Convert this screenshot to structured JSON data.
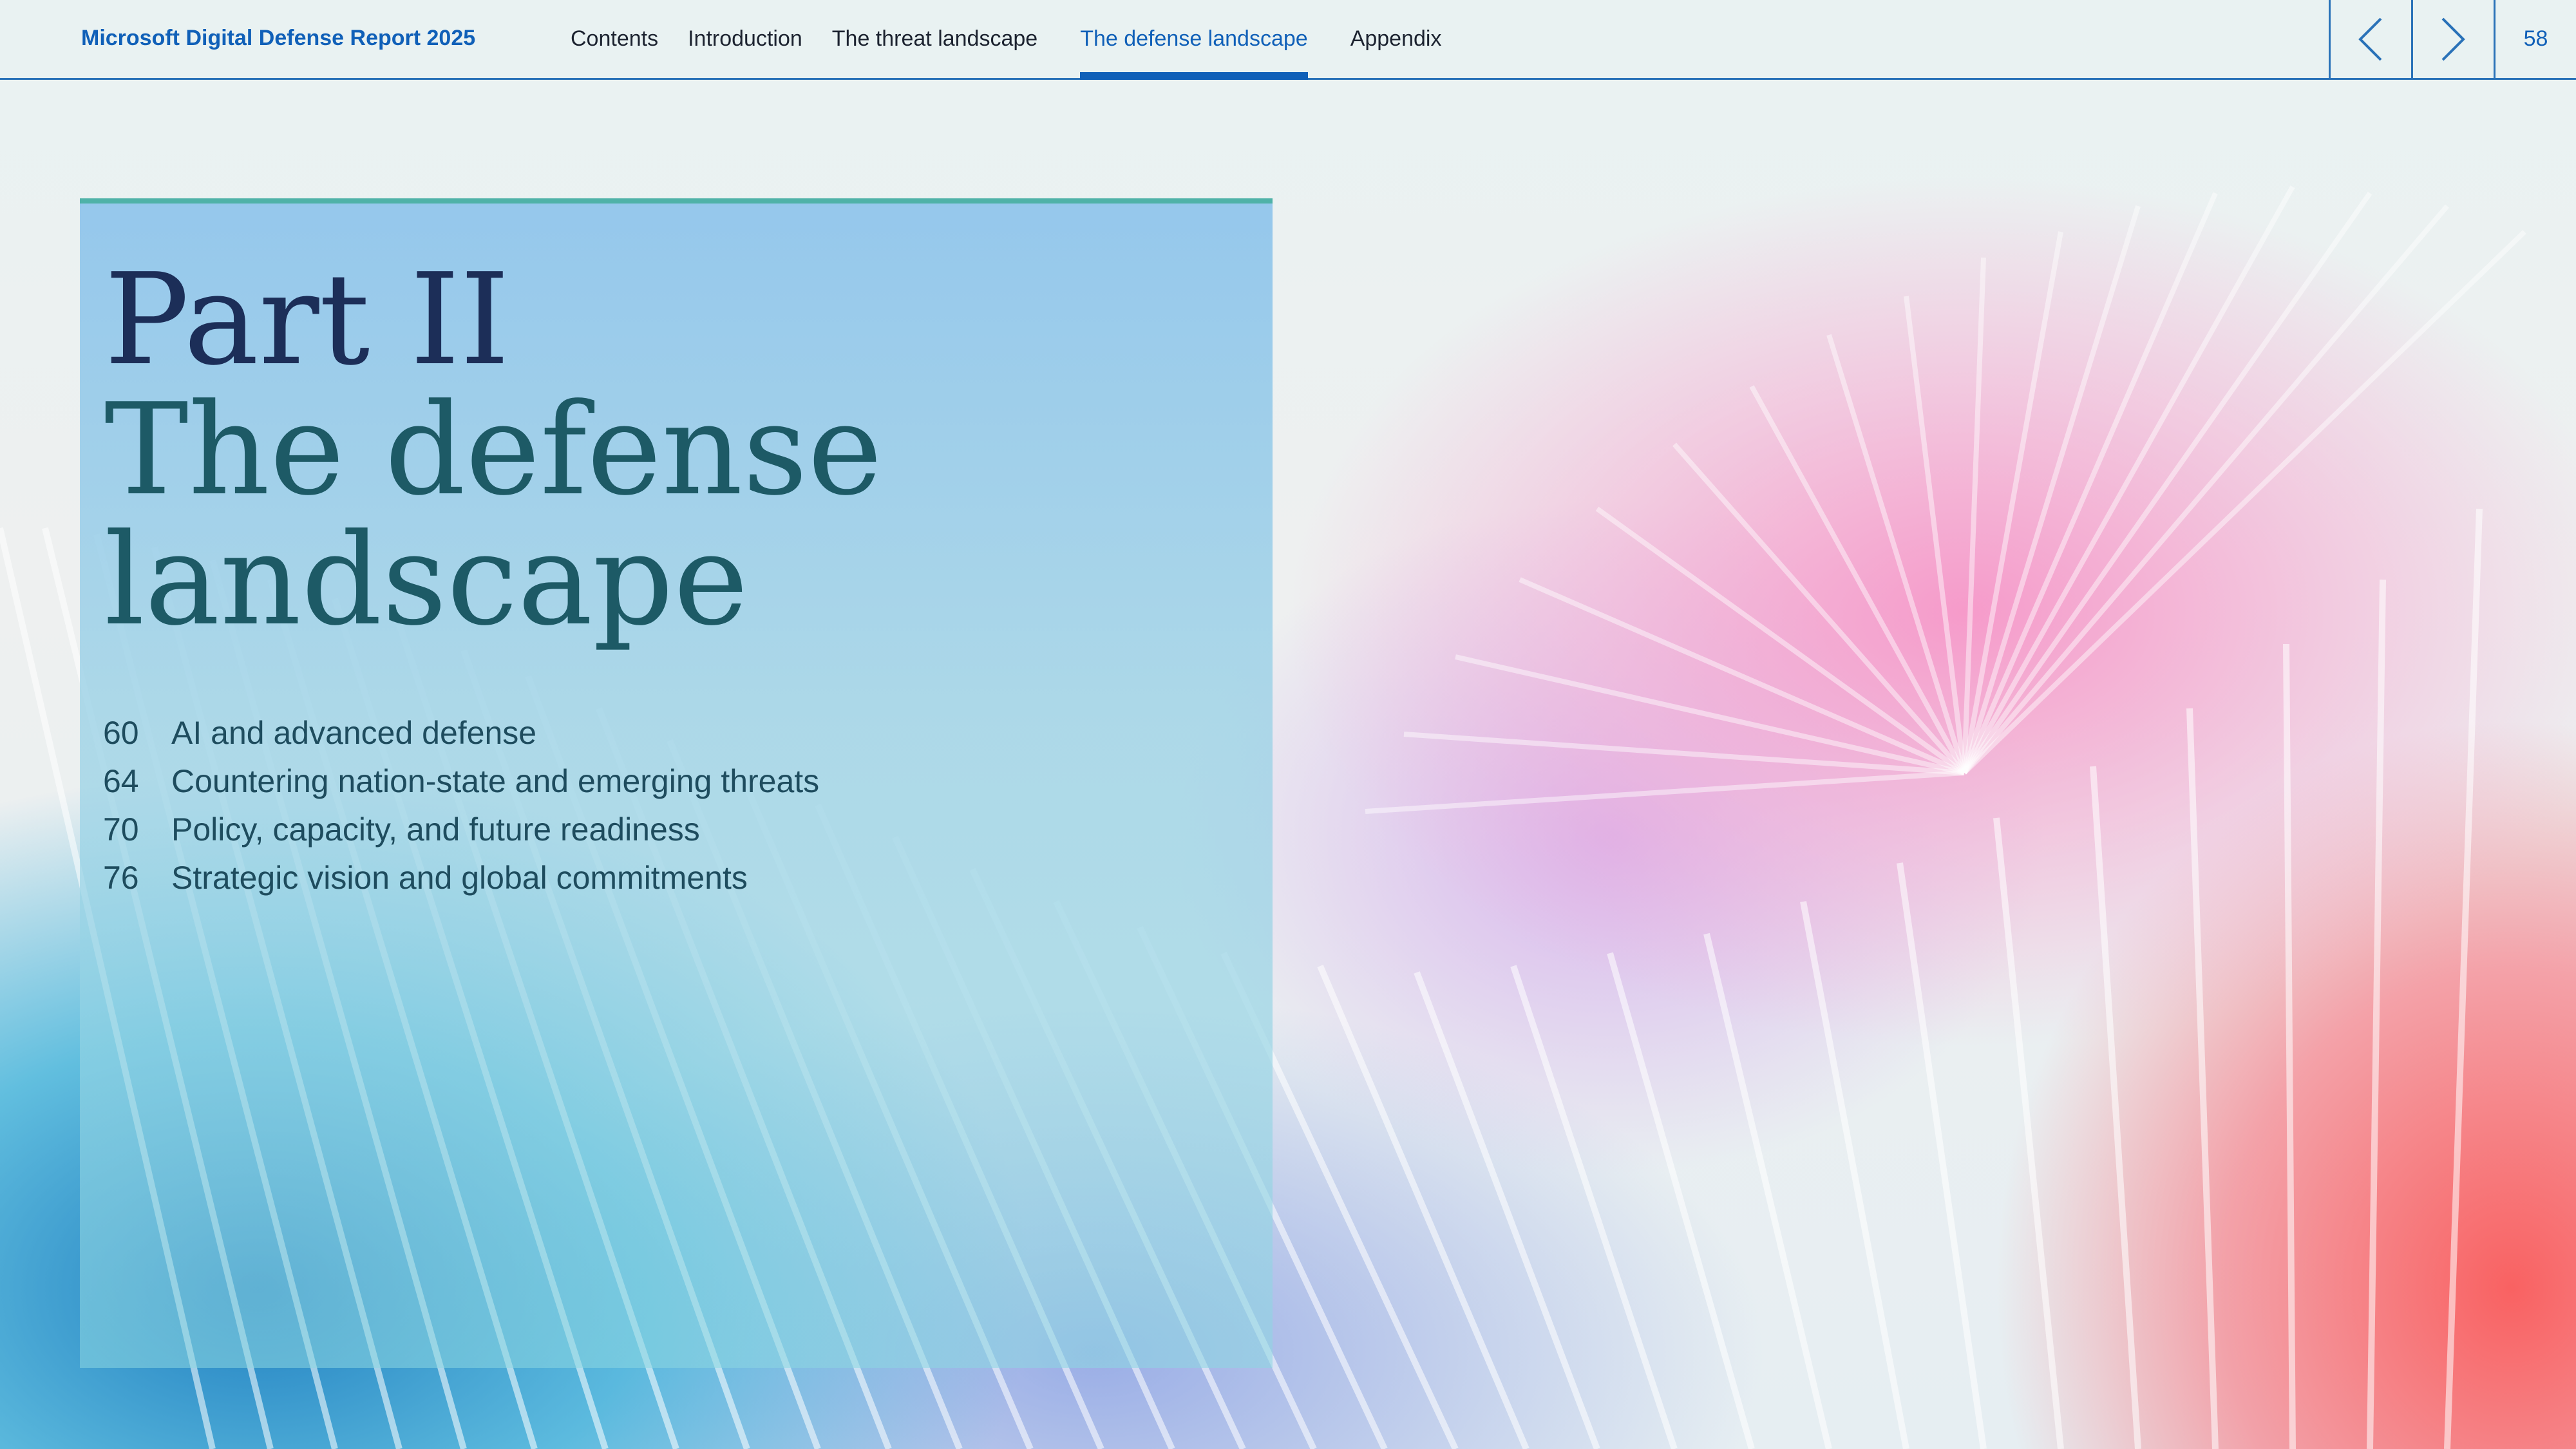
{
  "header": {
    "brand": "Microsoft Digital Defense Report 2025",
    "nav": [
      {
        "label": "Contents"
      },
      {
        "label": "Introduction"
      },
      {
        "label": "The threat landscape"
      },
      {
        "label": "The defense landscape",
        "active": true
      },
      {
        "label": "Appendix"
      }
    ],
    "prev_icon": "chevron-left-icon",
    "next_icon": "chevron-right-icon",
    "page_number": "58"
  },
  "panel": {
    "title_line1": "Part II",
    "title_line2": "The defense",
    "title_line3": "landscape",
    "toc": [
      {
        "page": "60",
        "label": "AI and advanced defense"
      },
      {
        "page": "64",
        "label": "Countering nation-state and emerging threats"
      },
      {
        "page": "70",
        "label": "Policy, capacity, and future readiness"
      },
      {
        "page": "76",
        "label": "Strategic vision and global commitments"
      }
    ]
  },
  "colors": {
    "accent": "#1060b8",
    "title_part": "#1c2e58",
    "title_main": "#1d5a66",
    "panel_border": "#4fb2a8"
  }
}
